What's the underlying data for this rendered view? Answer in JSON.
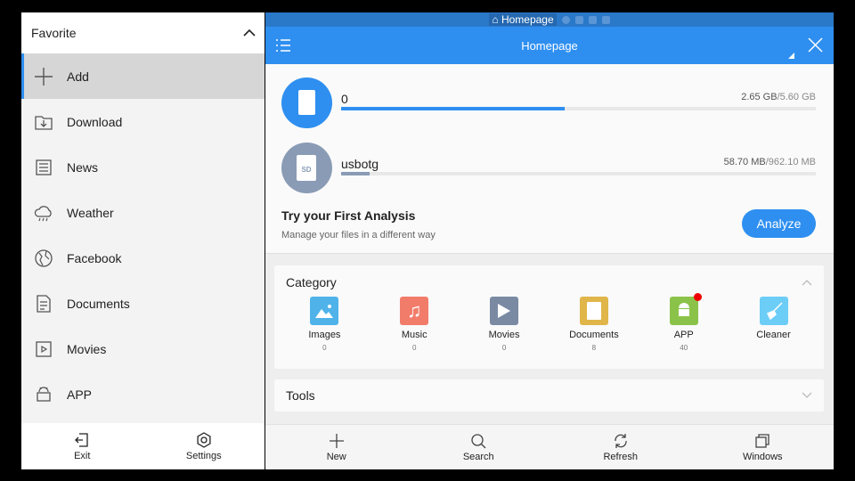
{
  "sidebar": {
    "title": "Favorite",
    "items": [
      {
        "label": "Add",
        "icon": "plus-icon"
      },
      {
        "label": "Download",
        "icon": "download-icon"
      },
      {
        "label": "News",
        "icon": "news-icon"
      },
      {
        "label": "Weather",
        "icon": "weather-icon"
      },
      {
        "label": "Facebook",
        "icon": "globe-icon"
      },
      {
        "label": "Documents",
        "icon": "document-icon"
      },
      {
        "label": "Movies",
        "icon": "movie-icon"
      },
      {
        "label": "APP",
        "icon": "app-icon"
      }
    ],
    "bottom": [
      {
        "label": "Exit"
      },
      {
        "label": "Settings"
      }
    ]
  },
  "tabstrip": {
    "active": "Homepage"
  },
  "header": {
    "title": "Homepage"
  },
  "storage": [
    {
      "name": "0",
      "used": "2.65 GB",
      "total": "/5.60 GB",
      "percent": 47,
      "color": "#2e8ff0"
    },
    {
      "name": "usbotg",
      "used": "58.70 MB",
      "total": "/962.10 MB",
      "percent": 6,
      "color": "#8a9bb5"
    }
  ],
  "analysis": {
    "title": "Try your First Analysis",
    "subtitle": "Manage your files in a different way",
    "button": "Analyze"
  },
  "category": {
    "title": "Category",
    "items": [
      {
        "label": "Images",
        "count": "0",
        "color": "#4fb3ea"
      },
      {
        "label": "Music",
        "count": "0",
        "color": "#f27c6a"
      },
      {
        "label": "Movies",
        "count": "0",
        "color": "#7a8aa3"
      },
      {
        "label": "Documents",
        "count": "8",
        "color": "#e0b54a"
      },
      {
        "label": "APP",
        "count": "40",
        "color": "#8bc34a"
      },
      {
        "label": "Cleaner",
        "count": "",
        "color": "#6ccdf7"
      }
    ]
  },
  "tools": {
    "title": "Tools"
  },
  "bottombar": [
    {
      "label": "New"
    },
    {
      "label": "Search"
    },
    {
      "label": "Refresh"
    },
    {
      "label": "Windows"
    }
  ]
}
